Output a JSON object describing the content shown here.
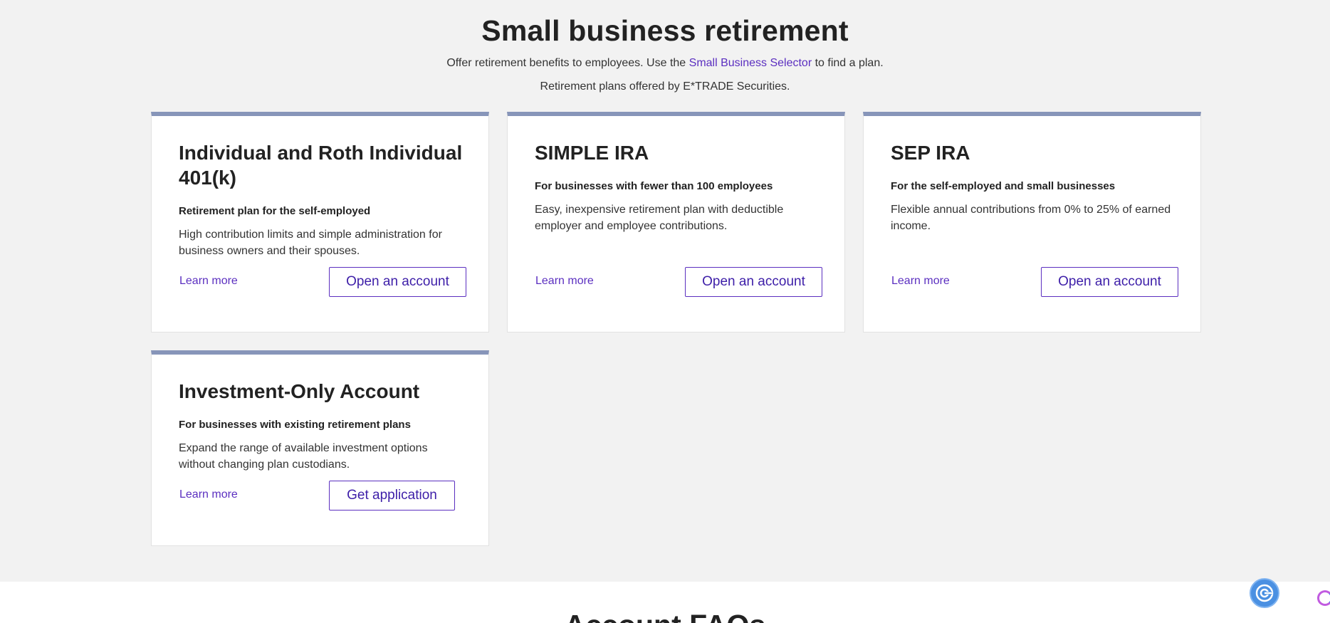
{
  "header": {
    "title": "Small business retirement",
    "intro_before": "Offer retirement benefits to employees. Use the ",
    "intro_link": "Small Business Selector",
    "intro_after": " to find a plan.",
    "provider_note": "Retirement plans offered by E*TRADE Securities."
  },
  "cards": [
    {
      "title": "Individual and Roth Individual 401(k)",
      "subtitle": "Retirement plan for the self-employed",
      "description": "High contribution limits and simple administration for business owners and their spouses.",
      "learn_more": "Learn more",
      "action": "Open an account"
    },
    {
      "title": "SIMPLE IRA",
      "subtitle": "For businesses with fewer than 100 employees",
      "description": "Easy, inexpensive retirement plan with deductible employer and employee contributions.",
      "learn_more": "Learn more",
      "action": "Open an account"
    },
    {
      "title": "SEP IRA",
      "subtitle": "For the self-employed and small businesses",
      "description": "Flexible annual contributions from 0% to 25% of earned income.",
      "learn_more": "Learn more",
      "action": "Open an account"
    },
    {
      "title": "Investment-Only Account",
      "subtitle": "For businesses with existing retirement plans",
      "description": "Expand the range of available investment options without changing plan custodians.",
      "learn_more": "Learn more",
      "action": "Get application"
    }
  ],
  "faq": {
    "title": "Account FAQs"
  },
  "icons": {
    "assistant": "assistant-chat-icon",
    "edge": "app-edge-icon"
  },
  "colors": {
    "accent": "#5b2fc0",
    "card_top_border": "#8795b9",
    "assistant_button": "#4a90e2"
  }
}
